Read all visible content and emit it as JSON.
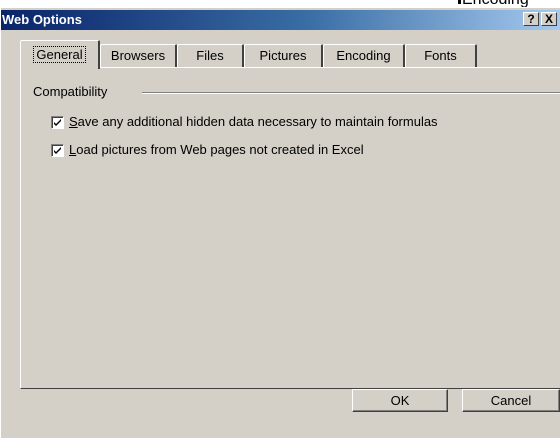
{
  "background_fragment": "Encoding",
  "window": {
    "title": "Web Options",
    "help_glyph": "?",
    "close_glyph": "X"
  },
  "tabs": [
    {
      "label": "General",
      "active": true
    },
    {
      "label": "Browsers"
    },
    {
      "label": "Files"
    },
    {
      "label": "Pictures"
    },
    {
      "label": "Encoding"
    },
    {
      "label": "Fonts"
    }
  ],
  "group": {
    "label": "Compatibility"
  },
  "options": [
    {
      "mnemonic": "S",
      "rest": "ave any additional hidden data necessary to maintain formulas",
      "checked": true
    },
    {
      "mnemonic": "L",
      "rest": "oad pictures from Web pages not created in Excel",
      "checked": true
    }
  ],
  "buttons": {
    "ok": "OK",
    "cancel": "Cancel"
  },
  "colors": {
    "dialog_face": "#d4d0c8",
    "titlebar_start": "#0a246a",
    "titlebar_end": "#a6caf0"
  }
}
